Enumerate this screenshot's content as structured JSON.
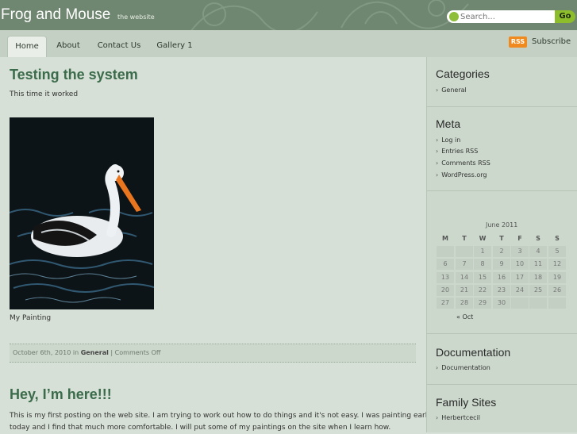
{
  "header": {
    "site_title": "Frog and Mouse",
    "site_description": "the website",
    "search_placeholder": "Search...",
    "go_label": "Go"
  },
  "nav": {
    "tabs": [
      {
        "label": "Home",
        "active": true
      },
      {
        "label": "About",
        "active": false
      },
      {
        "label": "Contact Us",
        "active": false
      },
      {
        "label": "Gallery 1",
        "active": false
      }
    ],
    "rss_badge": "RSS",
    "subscribe_label": "Subscribe"
  },
  "posts": [
    {
      "title": "Testing the system",
      "intro": "This time it worked",
      "image_caption": "My Painting",
      "meta": {
        "date_prefix": "October 6th, 2010 in ",
        "category": "General",
        "separator": " | ",
        "comments": "Comments Off"
      }
    },
    {
      "title": "Hey, I’m here!!!",
      "body_line1": "This is my first posting on the web site. I am trying to work out how to do things and it's not easy. I was painting earlier",
      "body_line2": "today and I find that much more comfortable. I will put some of my paintings on the site when I learn how."
    }
  ],
  "sidebar": {
    "categories": {
      "title": "Categories",
      "items": [
        "General"
      ]
    },
    "meta": {
      "title": "Meta",
      "items": [
        "Log in",
        "Entries RSS",
        "Comments RSS",
        "WordPress.org"
      ]
    },
    "calendar": {
      "caption": "June 2011",
      "headers": [
        "M",
        "T",
        "W",
        "T",
        "F",
        "S",
        "S"
      ],
      "weeks": [
        [
          "",
          "",
          "1",
          "2",
          "3",
          "4",
          "5"
        ],
        [
          "6",
          "7",
          "8",
          "9",
          "10",
          "11",
          "12"
        ],
        [
          "13",
          "14",
          "15",
          "16",
          "17",
          "18",
          "19"
        ],
        [
          "20",
          "21",
          "22",
          "23",
          "24",
          "25",
          "26"
        ],
        [
          "27",
          "28",
          "29",
          "30",
          "",
          "",
          ""
        ]
      ],
      "prev_link": "« Oct"
    },
    "documentation": {
      "title": "Documentation",
      "items": [
        "Documentation"
      ]
    },
    "family_sites": {
      "title": "Family Sites",
      "items": [
        "Herbertcecil"
      ]
    }
  },
  "colors": {
    "header_bg": "#6f8670",
    "accent_green": "#3b6b4a",
    "go_button": "#8dbd2a",
    "rss_orange": "#f08a1e"
  }
}
